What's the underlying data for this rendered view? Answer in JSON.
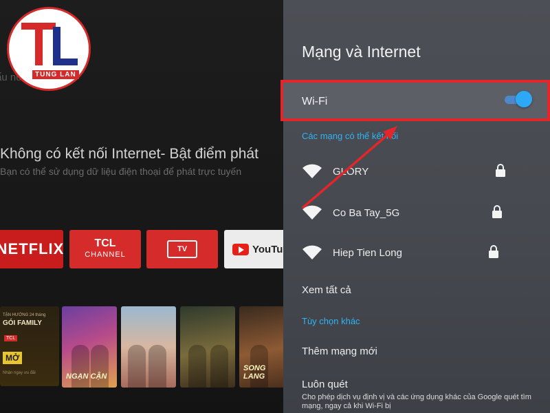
{
  "home": {
    "voice_hint": "ẩu nói \"Chơi nhạc\"",
    "banner_title": "Không có kết nối Internet- Bật điểm phát",
    "banner_subtitle": "Bạn có thể sử dụng dữ liệu điện thoại để phát trực tuyến",
    "logo": {
      "text": "TL",
      "caption": "TUNG LAN"
    },
    "apps": [
      {
        "label": "NETFLIX"
      },
      {
        "label": "TCL",
        "sublabel": "CHANNEL"
      },
      {
        "label": "TV"
      },
      {
        "label": "YouTube"
      }
    ],
    "promo": {
      "small": "TẶN HƯỚNG 24 tháng",
      "title": "GÓI FAMILY",
      "badge": "TCL",
      "cta": "MỞ",
      "note": "Nhận ngay ưu đãi"
    },
    "posters": [
      "NGẠN CẬN",
      "",
      "",
      "SONG LANG"
    ]
  },
  "settings": {
    "title": "Mạng và Internet",
    "wifi": {
      "label": "Wi-Fi",
      "enabled": true
    },
    "available_label": "Các mạng có thể kết nối",
    "networks": [
      {
        "name": "GLORY",
        "secured": true
      },
      {
        "name": "Co Ba Tay_5G",
        "secured": true
      },
      {
        "name": "Hiep Tien Long",
        "secured": true
      }
    ],
    "see_all": "Xem tất cả",
    "other_options_label": "Tùy chọn khác",
    "add_network": "Thêm mạng mới",
    "always_scan": {
      "label": "Luôn quét",
      "description": "Cho phép dịch vụ định vị và các ứng dụng khác của Google quét tìm mạng, ngay cả khi Wi-Fi bị"
    }
  },
  "colors": {
    "highlight_border": "#e2262a",
    "accent_blue": "#2fb4f4",
    "panel_bg": "#4a4d53"
  }
}
